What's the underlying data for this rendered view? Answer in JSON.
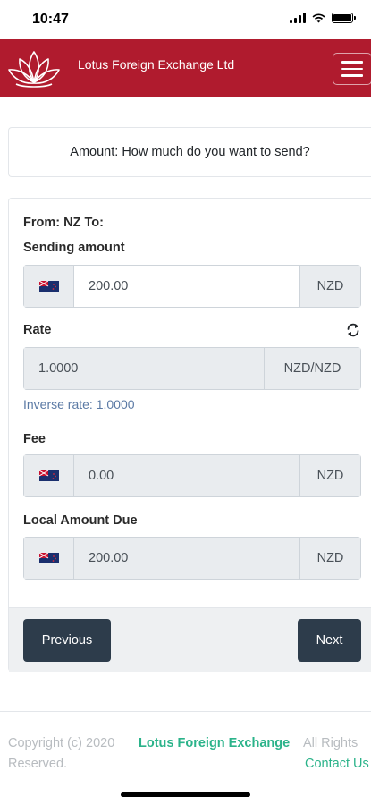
{
  "status_bar": {
    "time": "10:47",
    "icons": [
      "signal-icon",
      "wifi-icon",
      "battery-icon"
    ]
  },
  "navbar": {
    "brand_title": "Lotus Foreign Exchange Ltd",
    "logo_icon": "lotus-logo-icon",
    "menu_icon": "hamburger-menu-icon",
    "color": "#b01b2e"
  },
  "amount_prompt": "Amount: How much do you want to send?",
  "form": {
    "from_to": "From: NZ To:",
    "sending_amount": {
      "label": "Sending amount",
      "flag_icon": "nz-flag-icon",
      "value": "200.00",
      "currency": "NZD"
    },
    "rate": {
      "label": "Rate",
      "refresh_icon": "refresh-icon",
      "value": "1.0000",
      "pair": "NZD/NZD",
      "inverse": "Inverse rate: 1.0000"
    },
    "fee": {
      "label": "Fee",
      "flag_icon": "nz-flag-icon",
      "value": "0.00",
      "currency": "NZD"
    },
    "local_amount_due": {
      "label": "Local Amount Due",
      "flag_icon": "nz-flag-icon",
      "value": "200.00",
      "currency": "NZD"
    },
    "buttons": {
      "previous": "Previous",
      "next": "Next",
      "color": "#2d3c4b"
    }
  },
  "footer": {
    "copyright": "Copyright (c) 2020",
    "company_link": "Lotus Foreign Exchange",
    "rights": "All Rights",
    "reserved": "Reserved.",
    "contact_link": "Contact Us",
    "link_color": "#2bb38a"
  }
}
